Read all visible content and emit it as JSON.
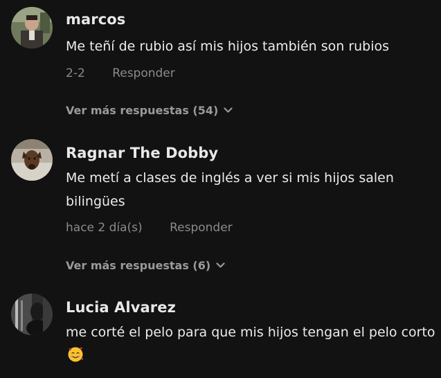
{
  "comments": [
    {
      "username": "marcos",
      "text": "Me teñí de rubio así mis hijos también son rubios",
      "date": "2-2",
      "reply_label": "Responder",
      "more_replies": "Ver más respuestas (54)",
      "avatar_icon": "user-avatar-portrait"
    },
    {
      "username": "Ragnar The Dobby",
      "text": "Me metí a clases de inglés a ver si mis hijos salen bilingües",
      "date": "hace 2 día(s)",
      "reply_label": "Responder",
      "more_replies": "Ver más respuestas (6)",
      "avatar_icon": "dog-avatar"
    },
    {
      "username": "Lucia Alvarez",
      "text": "me corté el pelo para que mis hijos tengan el pelo corto",
      "avatar_icon": "user-avatar-bw-photo",
      "emoji": "smiling-face-with-hearts"
    }
  ],
  "colors": {
    "background": "#121212",
    "primary_text": "#ececec",
    "secondary_text": "#8b8b8b",
    "more_text": "#9a9a9a"
  }
}
